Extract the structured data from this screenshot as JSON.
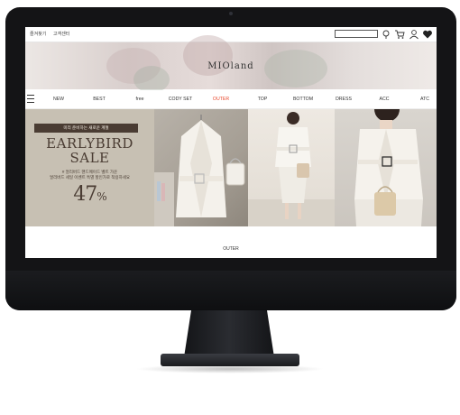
{
  "topbar": {
    "links": [
      "즐겨찾기",
      "고객센터"
    ],
    "search_placeholder": ""
  },
  "icons": [
    "search-icon",
    "cart-icon",
    "user-icon",
    "heart-icon"
  ],
  "header": {
    "logo": "MIOland"
  },
  "nav": {
    "items": [
      {
        "label": "NEW",
        "active": false
      },
      {
        "label": "BEST",
        "active": false
      },
      {
        "label": "free",
        "active": false
      },
      {
        "label": "CODY SET",
        "active": false
      },
      {
        "label": "OUTER",
        "active": true
      },
      {
        "label": "TOP",
        "active": false
      },
      {
        "label": "BOTTOM",
        "active": false
      },
      {
        "label": "DRESS",
        "active": false
      },
      {
        "label": "ACC",
        "active": false
      },
      {
        "label": "ATC",
        "active": false
      }
    ],
    "active_color": "#e8472b"
  },
  "promo": {
    "label": "미리 준비하는 새로운 계절",
    "title_line1": "EARLYBIRD",
    "title_line2": "SALE",
    "desc_line1": "# 얼리버드 핸드메이드 벨트 가운",
    "desc_line2": "얼리버드 세일 이벤트 특별 할인가로 착용하세요",
    "percent": "47",
    "percent_sign": "%"
  },
  "section": {
    "label": "OUTER"
  }
}
